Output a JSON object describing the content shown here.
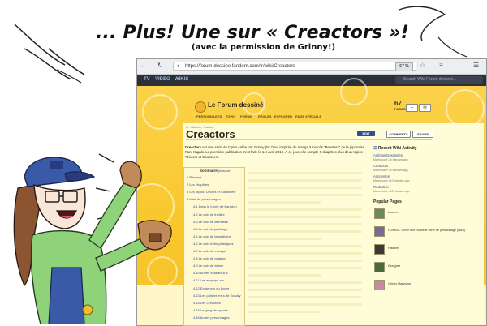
{
  "comic": {
    "title": "... Plus! Une sur « Creactors »!",
    "subtitle": "(avec la permission de Grinny!)"
  },
  "browser": {
    "url": "https://forum-dessine.fandom.com/fr/wiki/Creactors",
    "zoom": "67 %"
  },
  "wiki_nav": {
    "items": [
      "TV",
      "VIDEO",
      "WIKIS"
    ],
    "search_placeholder": "Search Wiki Forum dessiné..."
  },
  "wiki": {
    "name": "Le Forum dessiné",
    "menu": [
      "PERSONNAGES",
      "TOPIC",
      "FORUM",
      "RÈGLES",
      "EXPLORER",
      "PAGE SPÉCIALE"
    ],
    "pages_count": "67",
    "pages_label": "PAGES"
  },
  "article": {
    "breadcrumb": "Fr. Histoire, Histoire",
    "title": "Creactors",
    "edit_label": "EDIT",
    "comments_label": "COMMENTS",
    "share_label": "SHARE",
    "intro_bold": "Creactors",
    "intro": "est une série de topics créée par Grinny (M' One) inspirée du manga à succès \"Beasters\" de la japonaise Paru Itagaki. La première publication s'est faite le 1er avril 2019. À ce jour, elle compte 6 chapitres plus deux topics \"Décors et Coulisses\"."
  },
  "toc": {
    "title": "Sommaire",
    "hide": "[masquer]",
    "items": [
      "1 Résumé",
      "2 Les chapitres",
      "3 Les topics \"Décors et Coulisses\"",
      "4 Liste de personnages",
      "4.1 Dans le Lycée de Barryton",
      "4.2 Le club de théâtre",
      "4.3 Le club de littérature",
      "4.4 Le club de jardinage",
      "4.5 Le club de journalisme",
      "4.6 Le club d'arts plastiques",
      "4.7 Le club de musique",
      "4.8 Le club de natation",
      "4.9 Le club de danse",
      "4.10 Autres étudiant-e-s",
      "4.11 Les employé-e-s",
      "4.12 En dehors du Lycée",
      "4.13 Les policier.ère.s de Zoocity",
      "4.14 Les Creactors",
      "4.15 Le gang de hyènes",
      "4.16 Autres personnages"
    ]
  },
  "rail": {
    "activity_title": "Recent Wiki Activity",
    "activity": [
      {
        "page": "Ambitos Dessinées",
        "meta": "Marmouzet • 6 minutes ago"
      },
      {
        "page": "Creactors",
        "meta": "Marmouzet • 8 minutes ago"
      },
      {
        "page": "Anonymes",
        "meta": "Marmouzet • 10 minutes ago"
      },
      {
        "page": "Rédaction",
        "meta": "Marmouzet • 12 minutes ago"
      }
    ],
    "popular_title": "Popular Pages",
    "popular": [
      {
        "name": "Unsern",
        "color": "#6a8a5a"
      },
      {
        "name": "FLIKAS - Créer une nouvelle fiche de personnage (nom)",
        "color": "#7a6a9a"
      },
      {
        "name": "Histoire",
        "color": "#3a3a3a"
      },
      {
        "name": "Designer",
        "color": "#4a6a3a"
      },
      {
        "name": "Grinny Marydom",
        "color": "#c78aa0"
      }
    ]
  }
}
